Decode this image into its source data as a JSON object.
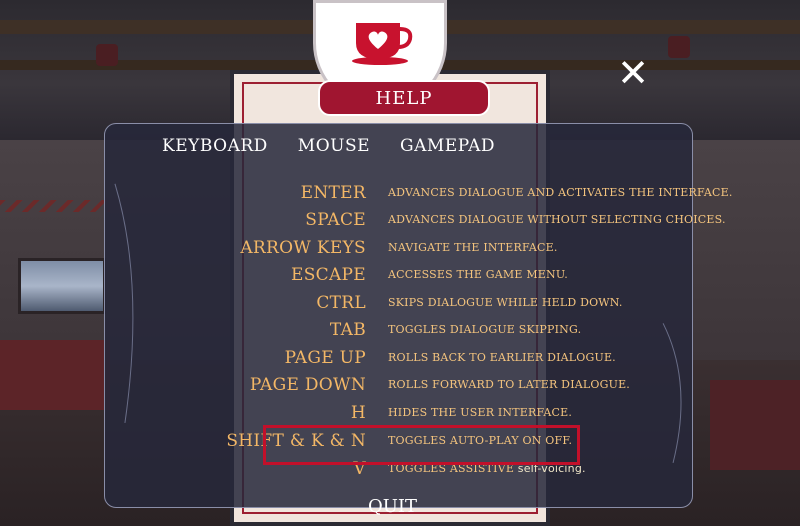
{
  "header": {
    "title": "HELP",
    "close_icon": "close-icon"
  },
  "tabs": [
    {
      "label": "KEYBOARD"
    },
    {
      "label": "MOUSE"
    },
    {
      "label": "GAMEPAD"
    }
  ],
  "keybindings": [
    {
      "key": "ENTER",
      "desc": "ADVANCES DIALOGUE AND ACTIVATES THE INTERFACE."
    },
    {
      "key": "SPACE",
      "desc": "ADVANCES DIALOGUE WITHOUT SELECTING CHOICES."
    },
    {
      "key": "ARROW KEYS",
      "desc": "NAVIGATE THE INTERFACE."
    },
    {
      "key": "ESCAPE",
      "desc": "ACCESSES THE GAME MENU."
    },
    {
      "key": "CTRL",
      "desc": "SKIPS DIALOGUE WHILE HELD DOWN."
    },
    {
      "key": "TAB",
      "desc": "TOGGLES DIALOGUE SKIPPING."
    },
    {
      "key": "PAGE UP",
      "desc": "ROLLS BACK TO EARLIER DIALOGUE."
    },
    {
      "key": "PAGE DOWN",
      "desc": "ROLLS FORWARD TO LATER DIALOGUE."
    },
    {
      "key": "H",
      "desc": "HIDES THE USER INTERFACE."
    },
    {
      "key": "SHIFT & K & N",
      "desc": "TOGGLES AUTO-PLAY ON OFF."
    },
    {
      "key": "V",
      "desc": "TOGGLES ASSISTIVE",
      "desc_suffix": "self-voicing."
    }
  ],
  "footer": {
    "quit_label": "QUIT"
  },
  "colors": {
    "accent": "#a01530",
    "key_text": "#f3b766",
    "highlight": "#c2102a"
  }
}
